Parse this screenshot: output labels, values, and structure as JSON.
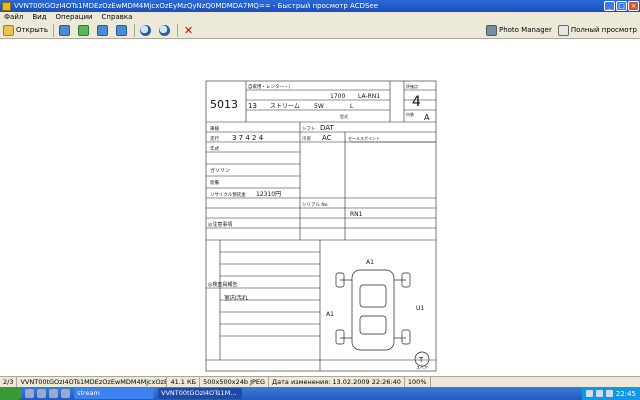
{
  "window": {
    "title": "VVNT00tGOzI4OTs1MDEzOzEwMDM4MjcxOzEyMzQyNzQ0MDMDA7MQ== - Быстрый просмотр ACDSee",
    "controls": [
      "_",
      "□",
      "×"
    ]
  },
  "menu": [
    "Файл",
    "Вид",
    "Операции",
    "Справка"
  ],
  "toolbar": {
    "open_label": "Открыть",
    "photo_manager_label": "Photo Manager",
    "fullscreen_label": "Полный просмотр"
  },
  "sheet": {
    "lot_number": "5013",
    "grade": "4",
    "interior_grade": "A",
    "year": "13",
    "model_text": "ストリーム",
    "displacement": "1700",
    "model_code": "LA-RN1",
    "model_code_bottom": "RN1",
    "grade_text": "L",
    "mileage": "3 7 4 2 4",
    "color": "5W",
    "shift": "DAT",
    "aircon": "AC",
    "fuel": "ガソリン",
    "recycle": "12310円",
    "inspection_note": "室内汚れ",
    "marks": {
      "a1_top": "A1",
      "a1_left": "A1",
      "u1": "U1",
      "spare": "T"
    },
    "labels": {
      "rental": "自家用・レンター・(",
      "section1": "◎注意事項",
      "section2": "◎検査員報告",
      "shaken": "車検",
      "mileage_label": "走行",
      "year_label": "年式",
      "shift_label": "シフト",
      "aircon_label": "冷房",
      "sales_point": "セールスポイント",
      "spare_label": "スペア",
      "features": "装備",
      "recycle_label": "リサイクル預託金",
      "serial": "シリアル No.",
      "grade_label": "評価点",
      "interior_label": "内装",
      "type_label": "型式"
    }
  },
  "status": {
    "index": "2/3",
    "filename": "VVNT00tGOzI4OTs1MDEzOzEwMDM4MjcxOzEyMzQyNzQ0MDMDA7MQ...",
    "size": "41.1 КБ",
    "dimensions": "500x500x24b JPEG",
    "date": "Дата изменения: 13.02.2009 22:26:40",
    "zoom": "100%"
  },
  "taskbar": {
    "task1": "stream",
    "task2": "VVNT00tGOzI4OTs1M...",
    "clock": "22:45"
  },
  "colors": {
    "titlebar": "#2a69d8",
    "chrome": "#ece9d8",
    "taskbar": "#245bc0"
  }
}
